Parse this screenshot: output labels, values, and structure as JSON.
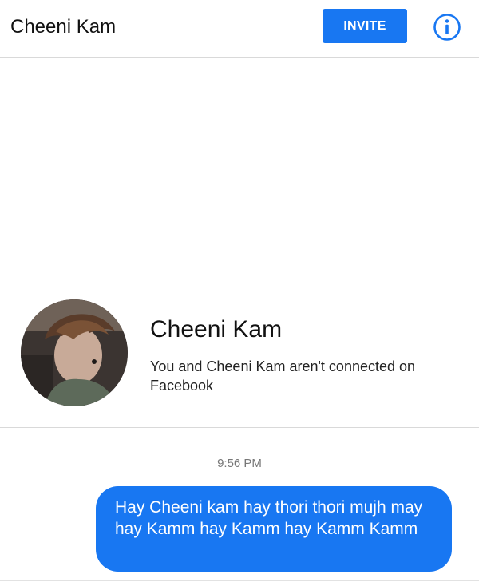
{
  "header": {
    "title": "Cheeni Kam",
    "invite_label": "INVITE",
    "info_icon": "info-circle-icon"
  },
  "profile": {
    "name": "Cheeni Kam",
    "subtitle": "You and Cheeni Kam aren't connected on Facebook"
  },
  "conversation": {
    "timestamp": "9:56 PM",
    "messages": [
      {
        "sender": "me",
        "text": "Hay Cheeni kam hay thori thori mujh may hay Kamm hay Kamm hay Kamm Kamm"
      }
    ]
  },
  "colors": {
    "accent": "#1877f2",
    "background": "#ffffff",
    "divider": "#d9d9d9",
    "timestamp": "#777777"
  }
}
